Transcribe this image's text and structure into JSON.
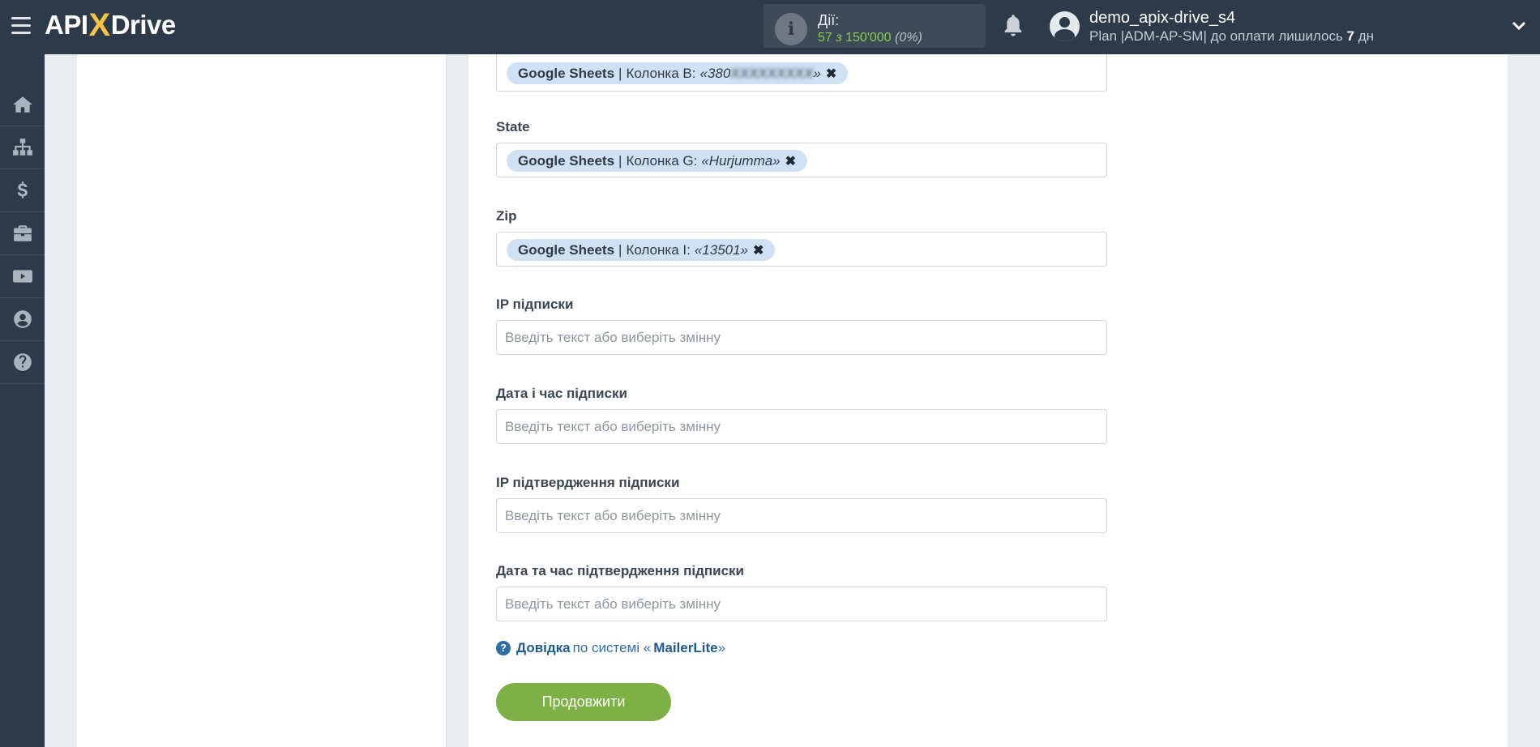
{
  "header": {
    "logo_left": "API",
    "logo_x": "X",
    "logo_right": "Drive",
    "actions_label": "Дії:",
    "actions_used": "57",
    "actions_sep": " з ",
    "actions_total": "150'000",
    "actions_pct": "(0%)",
    "username": "demo_apix-drive_s4",
    "plan_prefix": "Plan |ADM-AP-SM| до оплати лишилось ",
    "plan_days": "7",
    "plan_suffix": " дн"
  },
  "sidebar": {
    "items": [
      "home-icon",
      "sitemap-icon",
      "dollar-icon",
      "briefcase-icon",
      "youtube-icon",
      "user-icon",
      "help-icon"
    ]
  },
  "form": {
    "phone_tag": {
      "source": "Google Sheets",
      "column": "Колонка B:",
      "example_open": "«380",
      "example_hidden": "XXXXXXXXX",
      "example_close": "»"
    },
    "state": {
      "label": "State",
      "source": "Google Sheets",
      "column": "Колонка G:",
      "example": "«Hurjumma»"
    },
    "zip": {
      "label": "Zip",
      "source": "Google Sheets",
      "column": "Колонка I:",
      "example": "«13501»"
    },
    "ip_sub": {
      "label": "IP підписки",
      "placeholder": "Введіть текст або виберіть змінну"
    },
    "date_sub": {
      "label": "Дата і час підписки",
      "placeholder": "Введіть текст або виберіть змінну"
    },
    "ip_confirm": {
      "label": "IP підтвердження підписки",
      "placeholder": "Введіть текст або виберіть змінну"
    },
    "date_confirm": {
      "label": "Дата та час підтвердження підписки",
      "placeholder": "Введіть текст або виберіть змінну"
    },
    "separator": "|",
    "remove_glyph": "✖"
  },
  "help": {
    "link": "Довідка",
    "text": "по системі «",
    "system": "MailerLite",
    "close": "»"
  },
  "continue_label": "Продовжити",
  "colors": {
    "accent_green": "#7db045",
    "topbar": "#2d3a49",
    "tag_bg": "#cfe1f3"
  }
}
